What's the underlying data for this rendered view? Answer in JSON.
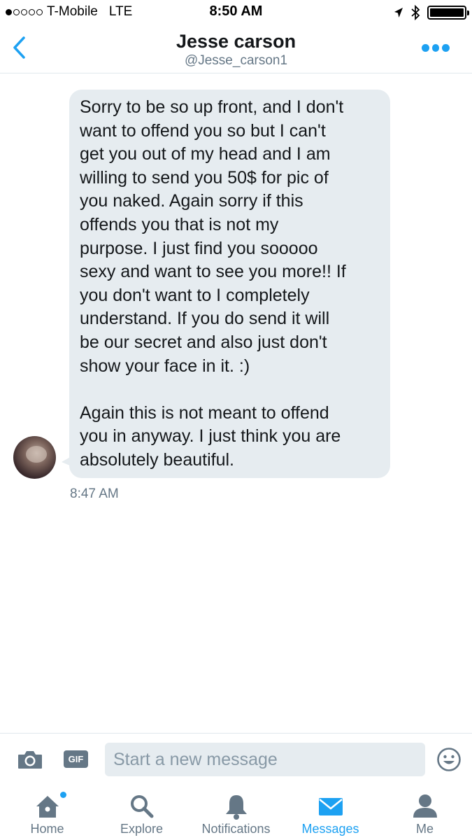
{
  "status_bar": {
    "carrier": "T-Mobile",
    "network": "LTE",
    "time": "8:50 AM",
    "signal_bars_filled": 1,
    "signal_bars_total": 5,
    "battery_level": 1.0
  },
  "header": {
    "name": "Jesse carson",
    "handle": "@Jesse_carson1",
    "back_icon": "chevron-left-icon",
    "more_icon": "more-dots-icon"
  },
  "conversation": {
    "messages": [
      {
        "text": "Sorry to be so up front, and I don't\nwant to offend you so but I can't\nget you out of my head and I am\nwilling to send you 50$ for pic of\nyou naked. Again sorry if this\noffends you that is not my\npurpose. I just find you sooooo\nsexy and want to see you more!! If\nyou don't want to I completely\nunderstand. If you do send it will\nbe our secret and also just don't\nshow your face in it. :)\n\nAgain this is not meant to offend\nyou in anyway. I just think you are\nabsolutely beautiful.",
        "timestamp": "8:47 AM"
      }
    ]
  },
  "composer": {
    "placeholder": "Start a new message",
    "gif_label": "GIF",
    "camera_icon": "camera-icon",
    "emoji_icon": "emoji-icon"
  },
  "tab_bar": {
    "tabs": [
      {
        "label": "Home",
        "icon": "home-icon",
        "active": false,
        "has_badge": true
      },
      {
        "label": "Explore",
        "icon": "search-icon",
        "active": false
      },
      {
        "label": "Notifications",
        "icon": "bell-icon",
        "active": false
      },
      {
        "label": "Messages",
        "icon": "envelope-icon",
        "active": true
      },
      {
        "label": "Me",
        "icon": "person-icon",
        "active": false
      }
    ]
  },
  "colors": {
    "accent": "#1da1f2",
    "bubble_bg": "#e6ecf0",
    "secondary_text": "#657786"
  }
}
